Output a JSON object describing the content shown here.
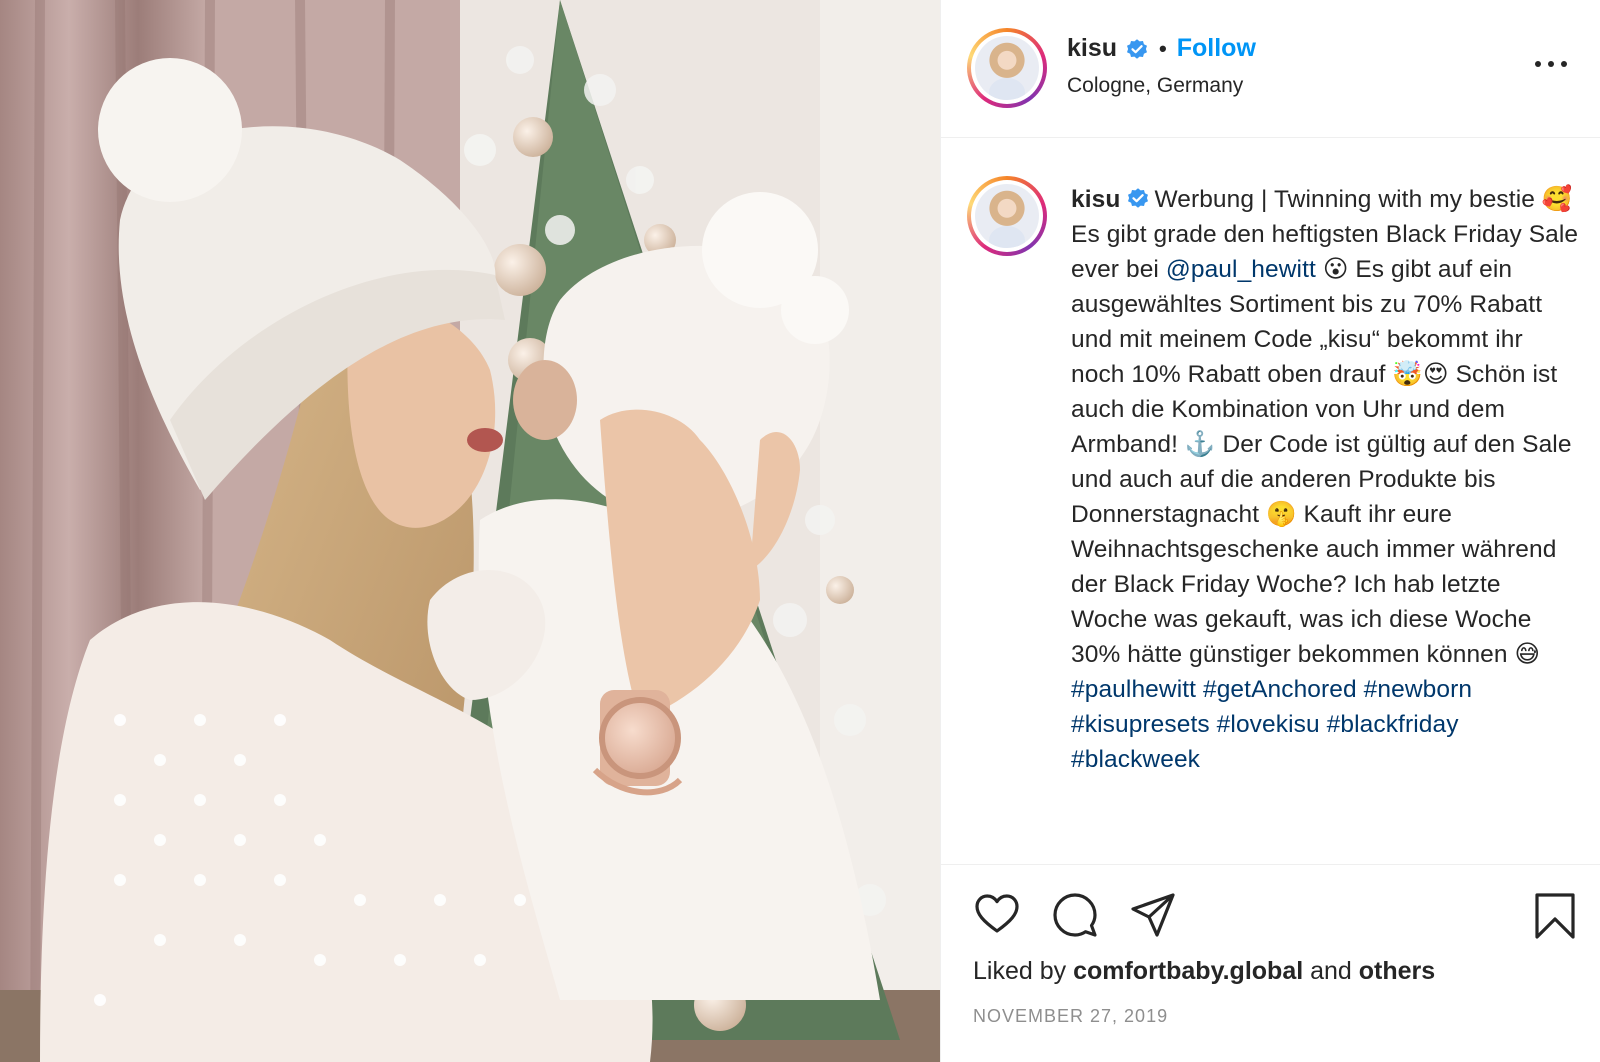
{
  "post": {
    "username": "kisu",
    "follow_label": "Follow",
    "dot": "•",
    "location": "Cologne, Germany",
    "caption": {
      "username": "kisu",
      "line1": "Werbung | Twinning with my bestie 🥰",
      "part_a": "Es gibt grade den heftigsten Black Friday Sale ever bei ",
      "mention": "@paul_hewitt",
      "part_b": " 😮 Es gibt auf ein ausgewähltes Sortiment bis zu 70% Rabatt und mit meinem Code „kisu“ bekommt ihr noch 10% Rabatt oben drauf 🤯😍 Schön ist auch die Kombination von Uhr und dem Armband! ⚓️ Der Code ist gültig auf den Sale und auch auf die anderen Produkte bis Donnerstagnacht 🤫 Kauft ihr eure Weihnachtsgeschenke auch immer während der Black Friday Woche? Ich hab letzte Woche was gekauft, was ich diese Woche 30% hätte günstiger bekommen können 😅",
      "hashtags": [
        "#paulhewitt",
        "#getAnchored",
        "#newborn",
        "#kisupresets",
        "#lovekisu",
        "#blackfriday",
        "#blackweek"
      ]
    },
    "likes": {
      "prefix": "Liked by ",
      "user": "comfortbaby.global",
      "middle": " and ",
      "suffix": "others"
    },
    "date": "NOVEMBER 27, 2019",
    "icons": {
      "verified": "verified-badge-icon",
      "more": "more-options-icon",
      "like": "heart-icon",
      "comment": "comment-icon",
      "share": "share-icon",
      "save": "bookmark-icon"
    },
    "colors": {
      "follow": "#0095f6",
      "verified": "#3897f0",
      "link": "#00376b",
      "date": "#8e8e8e"
    }
  }
}
